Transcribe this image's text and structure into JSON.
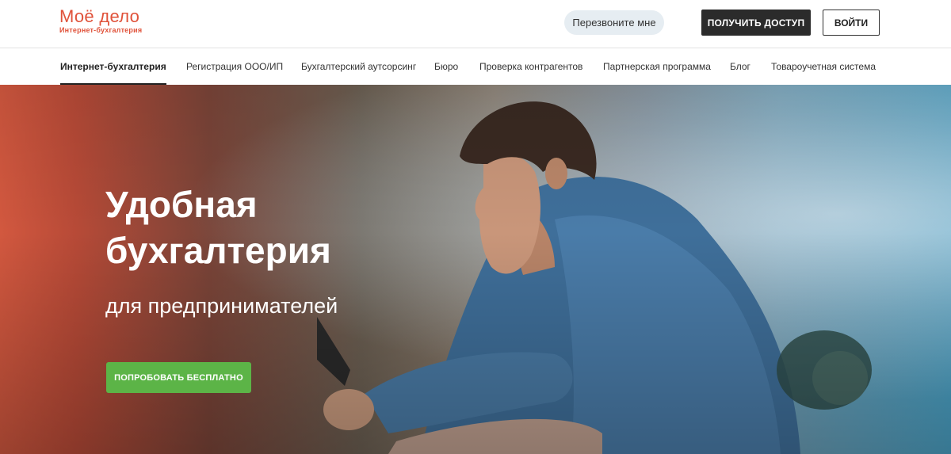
{
  "header": {
    "logo_main": "Моё дело",
    "logo_sub": "Интернет-бухгалтерия",
    "callback_label": "Перезвоните мне",
    "access_label": "ПОЛУЧИТЬ ДОСТУП",
    "login_label": "ВОЙТИ"
  },
  "nav": {
    "items": [
      {
        "label": "Интернет-бухгалтерия",
        "active": true
      },
      {
        "label": "Регистрация ООО/ИП"
      },
      {
        "label": "Бухгалтерский аутсорсинг"
      },
      {
        "label": "Бюро"
      },
      {
        "label": "Проверка контрагентов"
      },
      {
        "label": "Партнерская программа"
      },
      {
        "label": "Блог"
      },
      {
        "label": "Товароучетная система"
      }
    ]
  },
  "hero": {
    "title_line1": "Удобная",
    "title_line2": "бухгалтерия",
    "subtitle": "для предпринимателей",
    "cta_label": "ПОПРОБОВАТЬ БЕСПЛАТНО"
  },
  "colors": {
    "brand": "#e0523a",
    "cta": "#5cb447",
    "dark_button": "#2b2b2b"
  }
}
